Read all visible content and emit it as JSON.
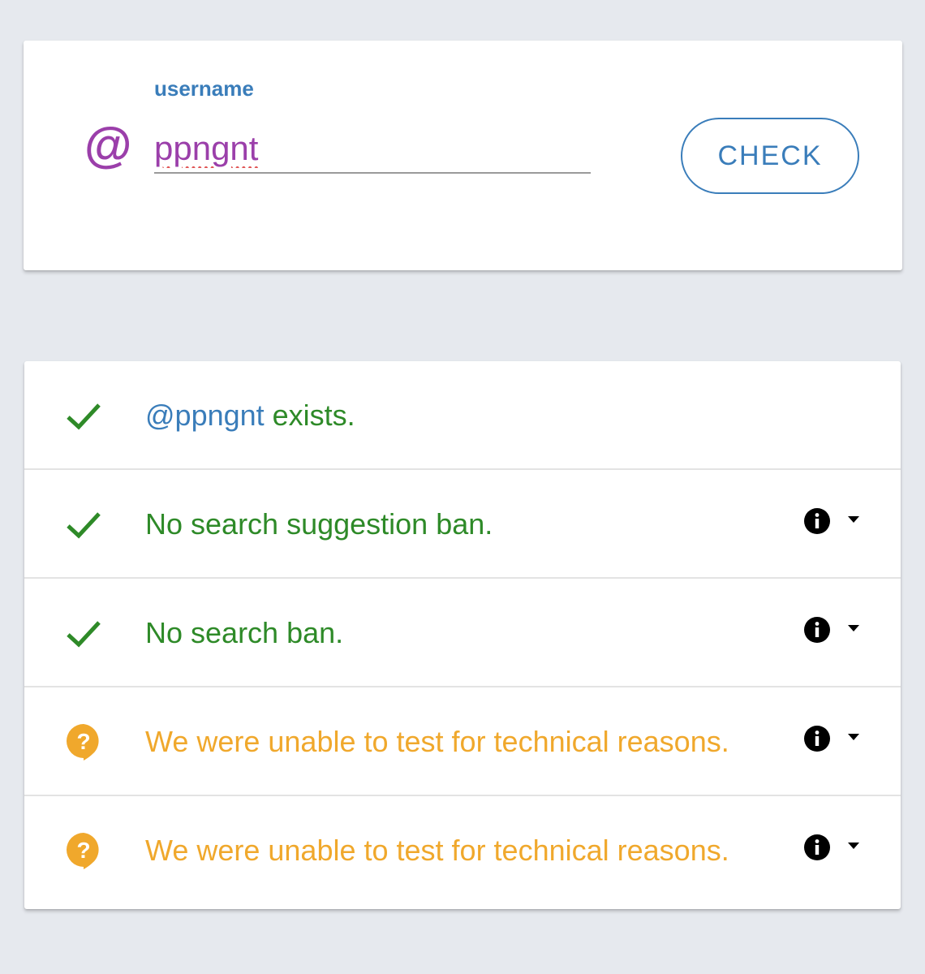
{
  "form": {
    "label": "username",
    "prefix_icon": "at-sign-icon",
    "username_value": "ppngnt",
    "check_label": "CHECK"
  },
  "results": [
    {
      "status": "ok",
      "icon": "check-icon",
      "handle": "@ppngnt",
      "text": " exists.",
      "has_details": false
    },
    {
      "status": "ok",
      "icon": "check-icon",
      "text": "No search suggestion ban.",
      "has_details": true
    },
    {
      "status": "ok",
      "icon": "check-icon",
      "text": "No search ban.",
      "has_details": true
    },
    {
      "status": "unknown",
      "icon": "question-bubble-icon",
      "text": "We were unable to test for technical reasons.",
      "has_details": true
    },
    {
      "status": "unknown",
      "icon": "question-bubble-icon",
      "text": "We were unable to test for technical reasons.",
      "has_details": true
    }
  ],
  "colors": {
    "ok": "#2e8a28",
    "unknown": "#f0a82c",
    "accent": "#3a7dba",
    "input_text": "#9b3faa"
  }
}
